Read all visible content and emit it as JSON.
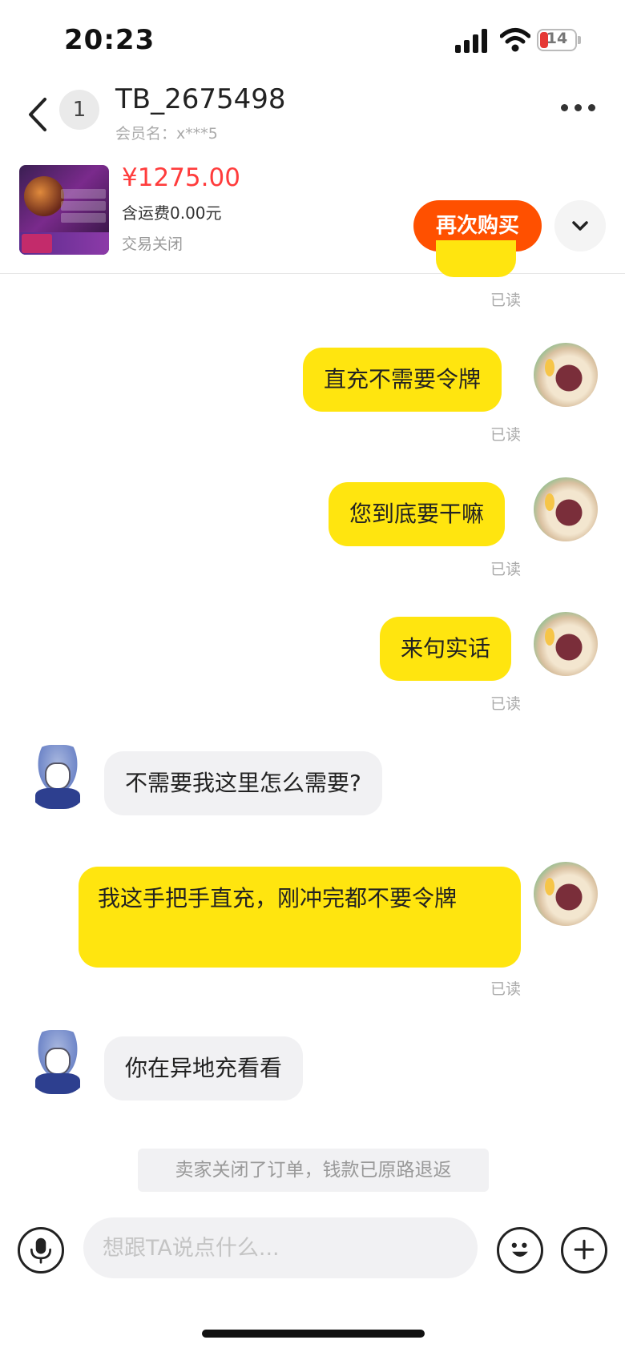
{
  "status_bar": {
    "time": "20:23",
    "battery": "14"
  },
  "header": {
    "unread_count": "1",
    "shop_name": "TB_2675498",
    "member_name": "会员名：x***5"
  },
  "product": {
    "price": "¥1275.00",
    "shipping": "含运费0.00元",
    "status": "交易关闭",
    "rebuy_label": "再次购买"
  },
  "messages": [
    {
      "from": "me",
      "text": "直充不需要令牌",
      "read": "已读"
    },
    {
      "from": "me",
      "text": "您到底要干嘛",
      "read": "已读"
    },
    {
      "from": "me",
      "text": "来句实话",
      "read": "已读"
    },
    {
      "from": "them",
      "text": "不需要我这里怎么需要?"
    },
    {
      "from": "me",
      "text": "我这手把手直充，刚冲完都不要令牌",
      "read": "已读"
    },
    {
      "from": "them",
      "text": "你在异地充看看"
    }
  ],
  "top_read": "已读",
  "system_note": "卖家关闭了订单，钱款已原路退返",
  "input": {
    "placeholder": "想跟TA说点什么..."
  },
  "colors": {
    "accent_orange": "#ff5000",
    "price_red": "#ff3c3c",
    "bubble_out": "#ffe50f",
    "bubble_in": "#f1f1f3"
  }
}
